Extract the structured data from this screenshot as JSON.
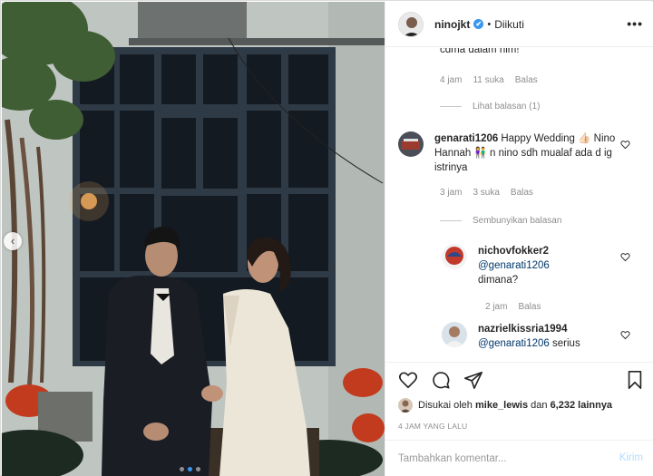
{
  "header": {
    "username": "ninojkt",
    "verified_mark": "✔",
    "separator": "•",
    "follow_status": "Diikuti",
    "more_label": "•••"
  },
  "comments": {
    "truncated_text": "cdma dalam hlm!",
    "first_meta": {
      "time": "4 jam",
      "likes": "11 suka",
      "reply": "Balas"
    },
    "view_replies": "Lihat balasan (1)",
    "items": [
      {
        "username": "genarati1206",
        "text": "Happy Wedding 👍🏻 Nino Hannah 👫 n nino sdh mualaf ada d ig istrinya",
        "time": "3 jam",
        "likes": "3 suka",
        "reply": "Balas"
      }
    ],
    "hide_replies": "Sembunyikan balasan",
    "replies": [
      {
        "username": "nichovfokker2",
        "mention": "@genarati1206",
        "text": "dimana?",
        "time": "2 jam",
        "reply": "Balas"
      },
      {
        "username": "nazrielkissria1994",
        "mention": "@genarati1206",
        "text": "serius"
      }
    ]
  },
  "likes": {
    "prefix": "Disukai oleh",
    "user": "mike_lewis",
    "conjunction": "dan",
    "others": "6,232 lainnya"
  },
  "timestamp": "4 JAM YANG LALU",
  "composer": {
    "placeholder": "Tambahkan komentar...",
    "post_label": "Kirim"
  },
  "photo": {
    "prev_arrow": "‹",
    "slide_count": 3,
    "active_slide": 2
  },
  "icons": [
    "heart-icon",
    "comment-icon",
    "share-icon",
    "bookmark-icon",
    "verified-icon",
    "more-icon",
    "chevron-left-icon"
  ],
  "colors": {
    "verified": "#3897f0",
    "mention": "#00376b",
    "meta": "#8e8e8e",
    "post_button": "#b3dbff"
  }
}
